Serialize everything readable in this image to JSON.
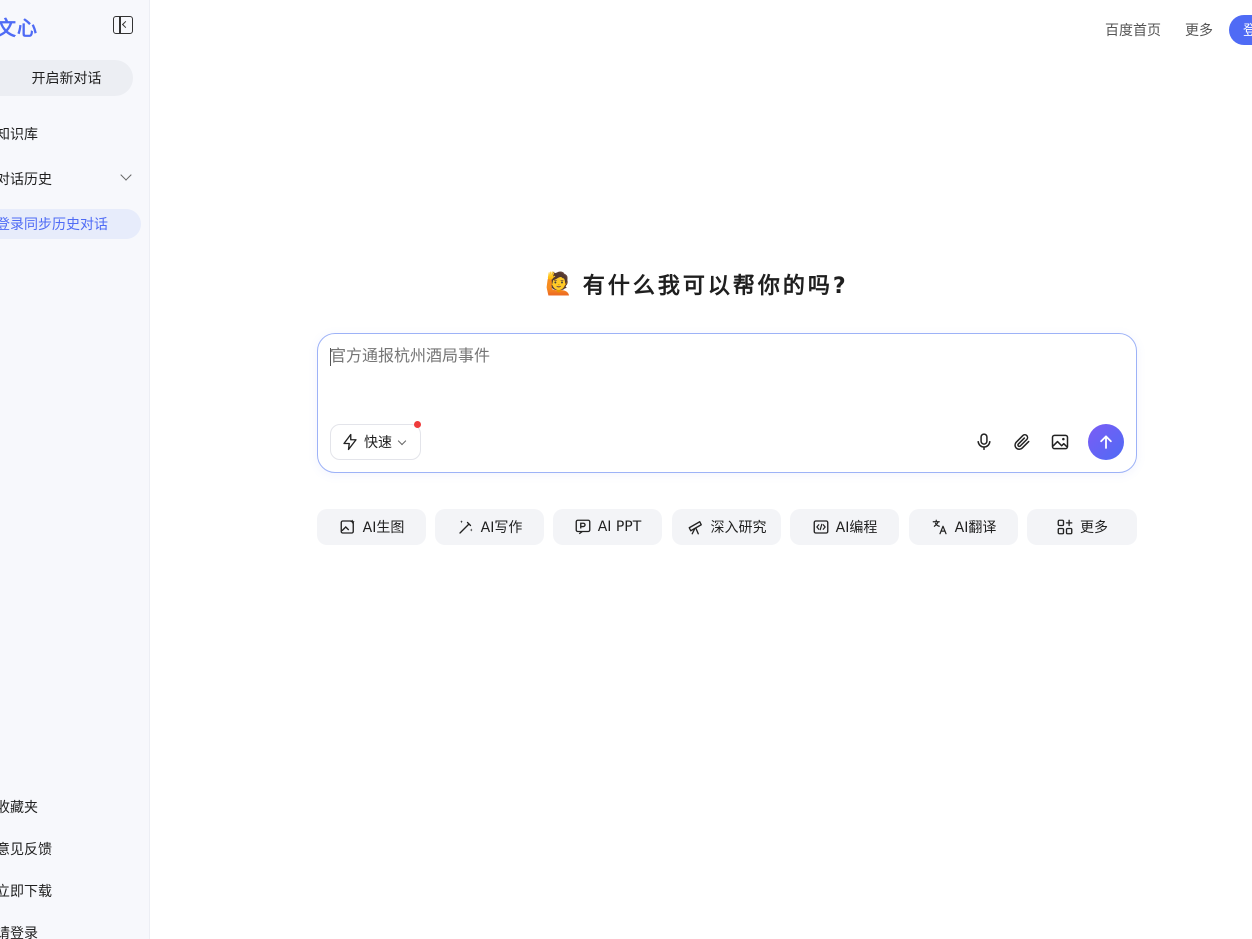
{
  "sidebar": {
    "logo": "文心",
    "new_chat": "开启新对话",
    "knowledge": "知识库",
    "history": "对话历史",
    "sync_login": "登录同步历史对话",
    "favorites": "收藏夹",
    "feedback": "意见反馈",
    "download": "立即下载",
    "login": "请登录"
  },
  "header": {
    "home": "百度首页",
    "more": "更多",
    "login": "登录"
  },
  "greeting": {
    "emoji": "🙋",
    "text": "有什么我可以帮你的吗?"
  },
  "input": {
    "placeholder": "官方通报杭州酒局事件",
    "mode": "快速"
  },
  "actions": [
    {
      "label": "AI生图",
      "icon": "image-gen-icon"
    },
    {
      "label": "AI写作",
      "icon": "pen-icon"
    },
    {
      "label": "AI PPT",
      "icon": "ppt-icon"
    },
    {
      "label": "深入研究",
      "icon": "telescope-icon"
    },
    {
      "label": "AI编程",
      "icon": "code-icon"
    },
    {
      "label": "AI翻译",
      "icon": "translate-icon"
    },
    {
      "label": "更多",
      "icon": "grid-icon"
    }
  ],
  "colors": {
    "accent": "#4f6bf5",
    "sidebar_bg": "#f7f8fc",
    "chip_bg": "#f3f4f7"
  }
}
